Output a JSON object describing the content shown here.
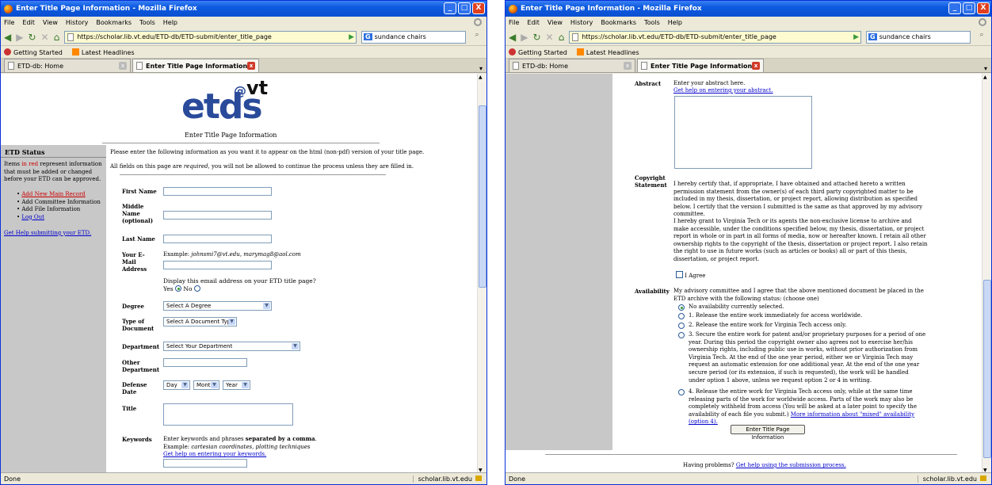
{
  "window": {
    "title": "Enter Title Page Information - Mozilla Firefox",
    "minimize": "_",
    "maximize": "□",
    "close": "X"
  },
  "menu": [
    "File",
    "Edit",
    "View",
    "History",
    "Bookmarks",
    "Tools",
    "Help"
  ],
  "nav": {
    "back": "◀",
    "forward": "▶",
    "reload": "↻",
    "stop": "✕",
    "home": "⌂",
    "url": "https://scholar.lib.vt.edu/ETD-db/ETD-submit/enter_title_page",
    "go": "▶",
    "engine": "G",
    "search_value": "sundance chairs",
    "search_icon": "⌕"
  },
  "bookmarks": [
    "Getting Started",
    "Latest Headlines"
  ],
  "tabs": [
    {
      "label": "ETD-db: Home"
    },
    {
      "label": "Enter Title Page Information"
    }
  ],
  "tab_list_arrow": "▾",
  "status": {
    "left": "Done",
    "host": "scholar.lib.vt.edu"
  },
  "page1": {
    "logo_main": "etds",
    "logo_at": "@",
    "logo_vt": "vt",
    "heading": "Enter Title Page Information",
    "sidebar": {
      "title": "ETD Status",
      "note_pre": "Items ",
      "note_red": "in red",
      "note_post": " represent information that must be added or changed before your ETD can be approved.",
      "steps": [
        "Add New Main Record",
        "Add Committee Information",
        "Add File Information",
        "Log Out"
      ],
      "help_link": "Get Help submitting your ETD."
    },
    "intro1": "Please enter the following information as you want it to appear on the html (non-pdf) version of your title page.",
    "intro2_pre": "All fields on this page are ",
    "intro2_em": "required",
    "intro2_post": ", you will not be allowed to continue the process unless they are filled in.",
    "fields": {
      "first_name": "First Name",
      "middle_name": "Middle Name (optional)",
      "last_name": "Last Name",
      "email": "Your E-Mail Address",
      "email_example_pre": "Example: ",
      "email_example": "johnsmi7@vt.edu, marymag8@aol.com",
      "display_q": "Display this email address on your ETD title page?",
      "yes": "Yes",
      "no": "No",
      "degree": "Degree",
      "degree_value": "Select A Degree",
      "doctype": "Type of Document",
      "doctype_value": "Select A Document Type",
      "department": "Department",
      "department_value": "Select Your Department",
      "other_dept": "Other Department",
      "defense_date": "Defense Date",
      "day": "Day",
      "month": "Month",
      "year": "Year",
      "title": "Title",
      "keywords": "Keywords",
      "kw_pre": "Enter keywords and phrases ",
      "kw_bold": "separated by a comma",
      "kw_post": ".",
      "kw_example_pre": "Example: ",
      "kw_example": "cartesian coordinates, plotting techniques",
      "kw_help": "Get help on entering your keywords."
    }
  },
  "page2": {
    "abstract_label": "Abstract",
    "abstract_prompt": "Enter your abstract here.",
    "abstract_help": "Get help on entering your abstract.",
    "copyright_label": "Copyright Statement",
    "copyright_p1": "I hereby certify that, if appropriate, I have obtained and attached hereto a written permission statement from the owner(s) of each third party copyrighted matter to be included in my thesis, dissertation, or project report, allowing distribution as specified below. I certify that the version I submitted is the same as that approved by my advisory committee.",
    "copyright_p2": "I hereby grant to Virginia Tech or its agents the non-exclusive license to archive and make accessible, under the conditions specified below, my thesis, dissertation, or project report in whole or in part in all forms of media, now or hereafter known. I retain all other ownership rights to the copyright of the thesis, dissertation or project report. I also retain the right to use in future works (such as articles or books) all or part of this thesis, dissertation, or project report.",
    "agree": "I Agree",
    "availability_label": "Availability",
    "availability_intro": "My advisory committee and I agree that the above mentioned document be placed in the ETD archive with the following status: (choose one)",
    "options": [
      "No availability currently selected.",
      "1. Release the entire work immediately for access worldwide.",
      "2. Release the entire work for Virginia Tech access only.",
      "3. Secure the entire work for patent and/or proprietary purposes for a period of one year. During this period the copyright owner also agrees not to exercise her/his ownership rights, including public use in works, without prior authorization from Virginia Tech. At the end of the one year period, either we or Virginia Tech may request an automatic extension for one additional year. At the end of the one year secure period (or its extension, if such is requested), the work will be handled under option 1 above, unless we request option 2 or 4 in writing.",
      "4. Release the entire work for Virginia Tech access only, while at the same time releasing parts of the work for worldwide access. Parts of the work may also be completely withheld from access (You will be asked at a later point to specify the availability of each file you submit.) "
    ],
    "mixed_link": "More information about \"mixed\" availability (option 4).",
    "submit": "Enter Title Page Information",
    "problems": "Having problems? ",
    "problems_link": "Get help using the submission process."
  }
}
